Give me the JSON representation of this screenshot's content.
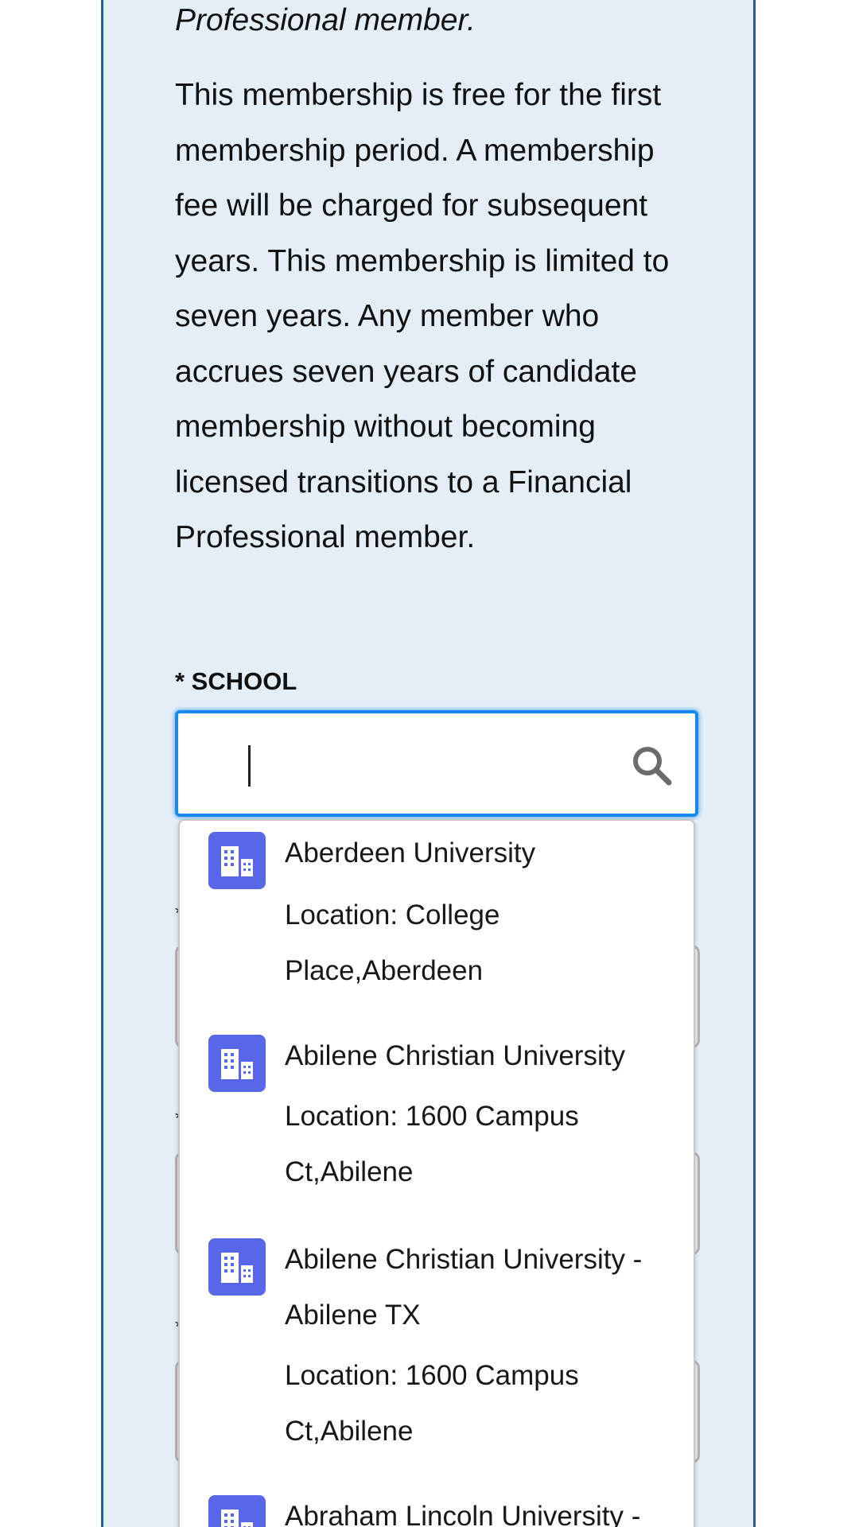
{
  "intro": {
    "italic_tail": "Professional member.",
    "description": "This membership is free for the first membership period. A membership fee will be charged for subsequent years. This membership is limited to seven years. Any member who accrues seven years of candidate membership without becoming licensed transitions to a Financial Professional member."
  },
  "school_field": {
    "label": "* SCHOOL",
    "value": "",
    "placeholder": ""
  },
  "colors": {
    "panel_background": "#e4eef7",
    "panel_border": "#1f5fa3",
    "focus_ring": "#1589ee",
    "option_icon_background": "#5867e8"
  },
  "icons": {
    "search": "search-icon",
    "option": "building-icon"
  },
  "dropdown": {
    "options": [
      {
        "title": "Aberdeen University",
        "location": "Location: College Place,Aberdeen"
      },
      {
        "title": "Abilene Christian University",
        "location": "Location: 1600 Campus Ct,Abilene"
      },
      {
        "title": "Abilene Christian University - Abilene TX",
        "location": "Location: 1600 Campus Ct,Abilene"
      },
      {
        "title": "Abraham Lincoln University -",
        "location": ""
      }
    ]
  }
}
